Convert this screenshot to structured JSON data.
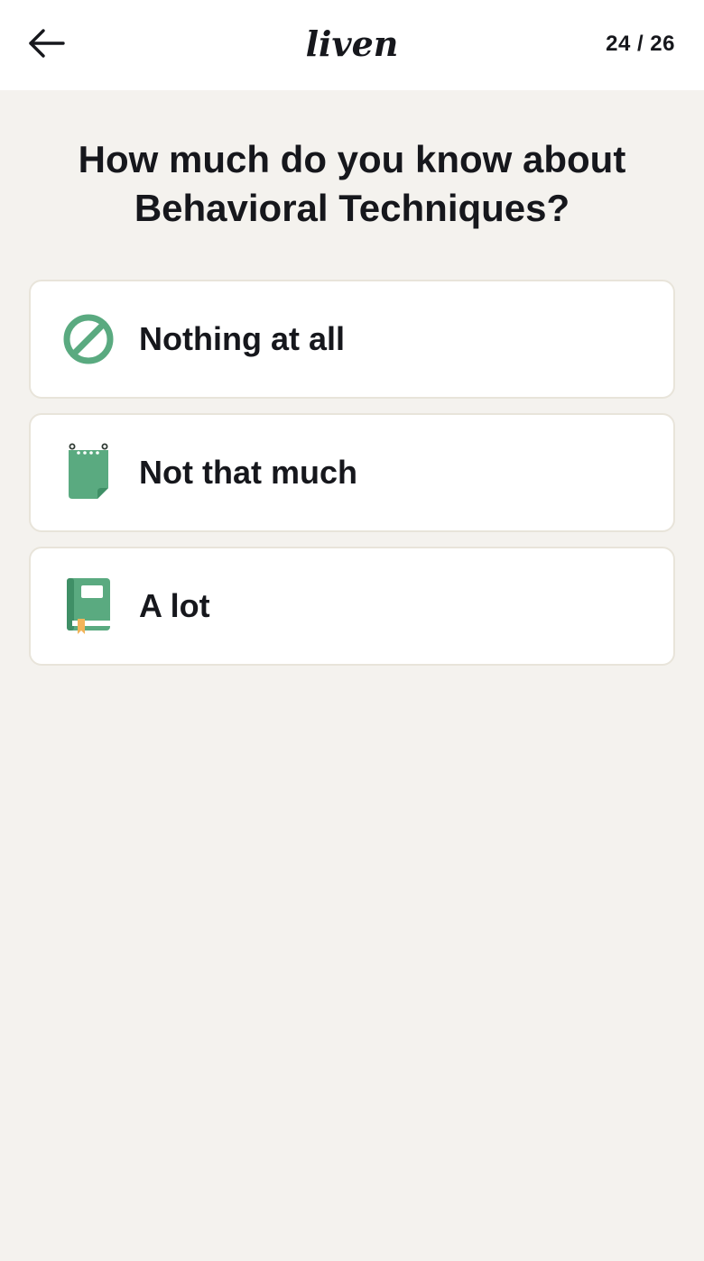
{
  "header": {
    "back_icon": "arrow-left-icon",
    "logo_text": "liven",
    "progress": "24 / 26"
  },
  "question": {
    "line1": "How much do you know about",
    "line2": "Behavioral Techniques?"
  },
  "options": [
    {
      "label": "Nothing at all",
      "icon": "prohibited-icon"
    },
    {
      "label": "Not that much",
      "icon": "notepad-icon"
    },
    {
      "label": "A lot",
      "icon": "book-icon"
    }
  ],
  "colors": {
    "background": "#f4f2ee",
    "card": "#ffffff",
    "card_border": "#e8e4da",
    "accent_green": "#5aaa80",
    "accent_dark_green": "#3f8f66",
    "bookmark": "#f2b45a",
    "text": "#16171c"
  }
}
